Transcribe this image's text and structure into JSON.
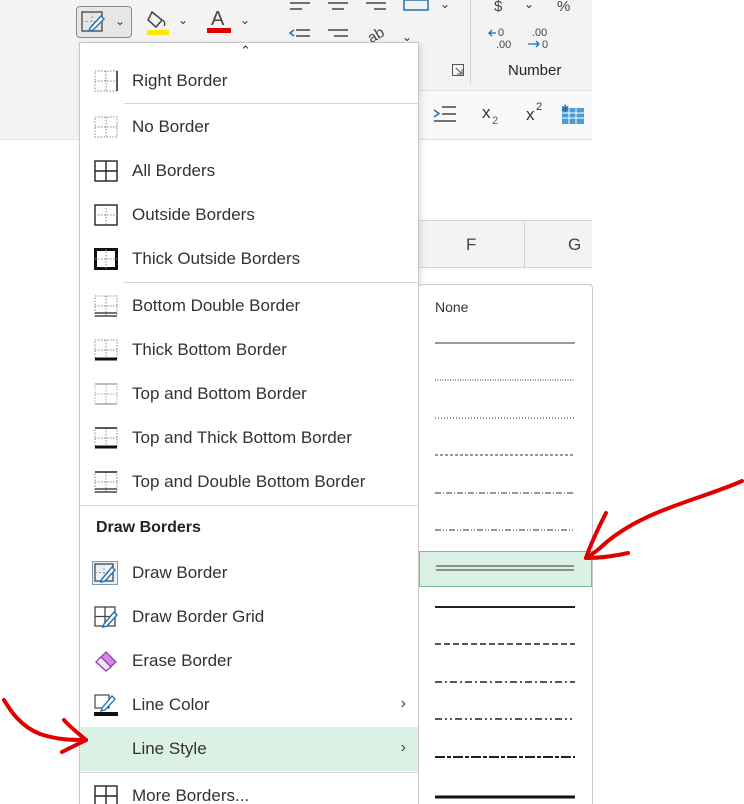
{
  "ribbon": {
    "number_label": "Number",
    "columns": [
      "F",
      "G"
    ]
  },
  "menu": {
    "items": [
      {
        "id": "right-border",
        "label": "Right Border",
        "icon": "right-border-icon"
      },
      {
        "id": "no-border",
        "label": "No Border",
        "icon": "no-border-icon"
      },
      {
        "id": "all-borders",
        "label": "All Borders",
        "icon": "all-borders-icon"
      },
      {
        "id": "outside-borders",
        "label": "Outside Borders",
        "icon": "outside-borders-icon"
      },
      {
        "id": "thick-outside-borders",
        "label": "Thick Outside Borders",
        "icon": "thick-outside-borders-icon"
      },
      {
        "id": "bottom-double-border",
        "label": "Bottom Double Border",
        "icon": "bottom-double-border-icon"
      },
      {
        "id": "thick-bottom-border",
        "label": "Thick Bottom Border",
        "icon": "thick-bottom-border-icon"
      },
      {
        "id": "top-and-bottom-border",
        "label": "Top and Bottom Border",
        "icon": "top-bottom-border-icon"
      },
      {
        "id": "top-and-thick-bottom-border",
        "label": "Top and Thick Bottom Border",
        "icon": "top-thick-bottom-border-icon"
      },
      {
        "id": "top-and-double-bottom-border",
        "label": "Top and Double Bottom Border",
        "icon": "top-double-bottom-border-icon"
      }
    ],
    "draw_heading": "Draw Borders",
    "draw_items": [
      {
        "id": "draw-border",
        "label": "Draw Border",
        "icon": "draw-border-icon"
      },
      {
        "id": "draw-border-grid",
        "label": "Draw Border Grid",
        "icon": "draw-border-grid-icon"
      },
      {
        "id": "erase-border",
        "label": "Erase Border",
        "icon": "eraser-icon"
      },
      {
        "id": "line-color",
        "label": "Line Color",
        "icon": "line-color-icon"
      },
      {
        "id": "line-style",
        "label": "Line Style",
        "icon": ""
      },
      {
        "id": "more-borders",
        "label": "More Borders...",
        "icon": "more-borders-icon"
      }
    ]
  },
  "line_style": {
    "none_label": "None",
    "selected_index": 6
  },
  "colors": {
    "hover": "#dcf1e6",
    "highlight_yellow": "#ffe600",
    "font_red": "#e00000",
    "annotation_red": "#e00000"
  }
}
